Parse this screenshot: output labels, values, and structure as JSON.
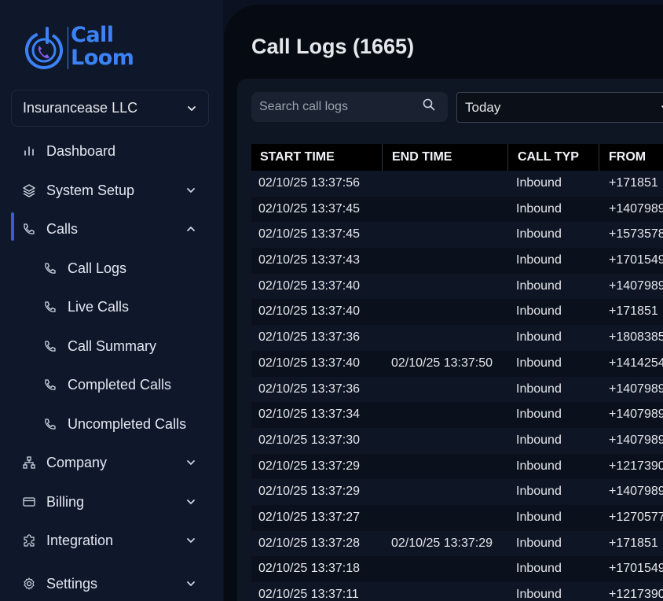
{
  "brand": {
    "line1": "Call",
    "line2": "Loom",
    "colors": {
      "primary": "#3b82f6",
      "accent": "#8b5cf6"
    }
  },
  "org_select": {
    "value": "Insurancease LLC"
  },
  "nav": [
    {
      "label": "Dashboard",
      "icon": "bar-chart-icon"
    },
    {
      "label": "System Setup",
      "icon": "layers-icon",
      "chevron": "chevron-down-icon"
    },
    {
      "label": "Calls",
      "icon": "phone-icon",
      "chevron": "chevron-up-icon",
      "active": true
    },
    {
      "label": "Call Logs",
      "icon": "phone-icon",
      "sub": true
    },
    {
      "label": "Live Calls",
      "icon": "phone-icon",
      "sub": true
    },
    {
      "label": "Call Summary",
      "icon": "phone-icon",
      "sub": true
    },
    {
      "label": "Completed Calls",
      "icon": "phone-icon",
      "sub": true
    },
    {
      "label": "Uncompleted Calls",
      "icon": "phone-icon",
      "sub": true
    },
    {
      "label": "Company",
      "icon": "org-chart-icon",
      "chevron": "chevron-down-icon"
    },
    {
      "label": "Billing",
      "icon": "credit-card-icon",
      "chevron": "chevron-down-icon"
    },
    {
      "label": "Integration",
      "icon": "puzzle-icon",
      "chevron": "chevron-down-icon"
    },
    {
      "label": "Settings",
      "icon": "gear-icon",
      "chevron": "chevron-down-icon"
    }
  ],
  "page": {
    "title": "Call Logs (1665)"
  },
  "search": {
    "placeholder": "Search call logs"
  },
  "date_filter": {
    "value": "Today"
  },
  "table": {
    "headers": [
      "START TIME",
      "END TIME",
      "CALL TYP",
      "FROM"
    ],
    "rows": [
      [
        "02/10/25 13:37:56",
        "",
        "Inbound",
        "+171851"
      ],
      [
        "02/10/25 13:37:45",
        "",
        "Inbound",
        "+1407989"
      ],
      [
        "02/10/25 13:37:45",
        "",
        "Inbound",
        "+1573578"
      ],
      [
        "02/10/25 13:37:43",
        "",
        "Inbound",
        "+1701549"
      ],
      [
        "02/10/25 13:37:40",
        "",
        "Inbound",
        "+1407989"
      ],
      [
        "02/10/25 13:37:40",
        "",
        "Inbound",
        "+171851"
      ],
      [
        "02/10/25 13:37:36",
        "",
        "Inbound",
        "+1808385"
      ],
      [
        "02/10/25 13:37:40",
        "02/10/25 13:37:50",
        "Inbound",
        "+1414254"
      ],
      [
        "02/10/25 13:37:36",
        "",
        "Inbound",
        "+1407989"
      ],
      [
        "02/10/25 13:37:34",
        "",
        "Inbound",
        "+1407989"
      ],
      [
        "02/10/25 13:37:30",
        "",
        "Inbound",
        "+1407989"
      ],
      [
        "02/10/25 13:37:29",
        "",
        "Inbound",
        "+1217390"
      ],
      [
        "02/10/25 13:37:29",
        "",
        "Inbound",
        "+1407989"
      ],
      [
        "02/10/25 13:37:27",
        "",
        "Inbound",
        "+1270577"
      ],
      [
        "02/10/25 13:37:28",
        "02/10/25 13:37:29",
        "Inbound",
        "+171851"
      ],
      [
        "02/10/25 13:37:18",
        "",
        "Inbound",
        "+1701549"
      ],
      [
        "02/10/25 13:37:11",
        "",
        "Inbound",
        "+1217390"
      ]
    ]
  }
}
